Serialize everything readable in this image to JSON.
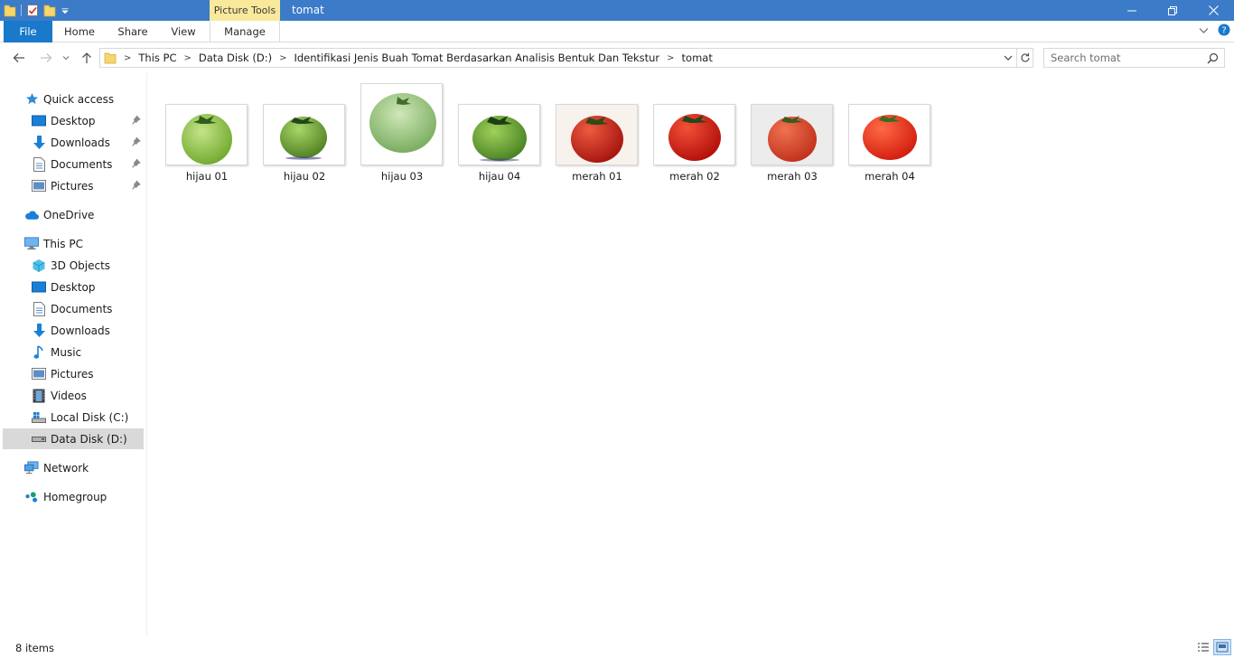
{
  "window": {
    "title": "tomat",
    "context_tab": "Picture Tools"
  },
  "ribbon": {
    "tabs": [
      {
        "label": "File"
      },
      {
        "label": "Home"
      },
      {
        "label": "Share"
      },
      {
        "label": "View"
      },
      {
        "label": "Manage"
      }
    ]
  },
  "address": {
    "breadcrumbs": [
      "This PC",
      "Data Disk (D:)",
      "Identifikasi Jenis Buah Tomat Berdasarkan Analisis Bentuk Dan Tekstur",
      "tomat"
    ]
  },
  "search": {
    "placeholder": "Search tomat"
  },
  "sidebar": {
    "items": [
      {
        "label": "Quick access",
        "icon": "star-icon",
        "pinned": false
      },
      {
        "label": "Desktop",
        "icon": "desktop-icon",
        "pinned": true
      },
      {
        "label": "Downloads",
        "icon": "download-arrow-icon",
        "pinned": true
      },
      {
        "label": "Documents",
        "icon": "document-icon",
        "pinned": true
      },
      {
        "label": "Pictures",
        "icon": "pictures-icon",
        "pinned": true
      },
      {
        "label": "OneDrive",
        "icon": "cloud-icon",
        "pinned": false
      },
      {
        "label": "This PC",
        "icon": "computer-icon",
        "pinned": false
      },
      {
        "label": "3D Objects",
        "icon": "cube-icon",
        "pinned": false
      },
      {
        "label": "Desktop",
        "icon": "desktop-icon",
        "pinned": false
      },
      {
        "label": "Documents",
        "icon": "document-icon",
        "pinned": false
      },
      {
        "label": "Downloads",
        "icon": "download-arrow-icon",
        "pinned": false
      },
      {
        "label": "Music",
        "icon": "music-note-icon",
        "pinned": false
      },
      {
        "label": "Pictures",
        "icon": "pictures-icon",
        "pinned": false
      },
      {
        "label": "Videos",
        "icon": "film-icon",
        "pinned": false
      },
      {
        "label": "Local Disk (C:)",
        "icon": "windows-drive-icon",
        "pinned": false
      },
      {
        "label": "Data Disk (D:)",
        "icon": "drive-icon",
        "pinned": false,
        "selected": true
      },
      {
        "label": "Network",
        "icon": "network-icon",
        "pinned": false
      },
      {
        "label": "Homegroup",
        "icon": "homegroup-icon",
        "pinned": false
      }
    ]
  },
  "files": [
    {
      "name": "hijau 01",
      "color": "#8cc44a"
    },
    {
      "name": "hijau 02",
      "color": "#6fa82c"
    },
    {
      "name": "hijau 03",
      "color": "#9ccd7c"
    },
    {
      "name": "hijau 04",
      "color": "#6aa633"
    },
    {
      "name": "merah 01",
      "color": "#c9241a"
    },
    {
      "name": "merah 02",
      "color": "#d61d12"
    },
    {
      "name": "merah 03",
      "color": "#d9432a"
    },
    {
      "name": "merah 04",
      "color": "#e8311c"
    }
  ],
  "status": {
    "item_count": "8 items"
  },
  "colors": {
    "titlebar": "#3b7bc8",
    "file_tab": "#1979ca",
    "context_tab": "#f8e99c",
    "selection": "#d9d9d9"
  }
}
